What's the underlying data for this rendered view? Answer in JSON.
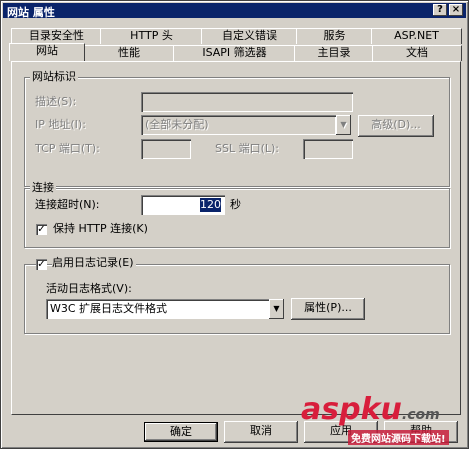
{
  "window": {
    "title": "网站 属性"
  },
  "title_buttons": {
    "help": "?",
    "close": "×"
  },
  "tabs_row1": [
    "目录安全性",
    "HTTP 头",
    "自定义错误",
    "服务",
    "ASP.NET"
  ],
  "tabs_row2": [
    "网站",
    "性能",
    "ISAPI 筛选器",
    "主目录",
    "文档"
  ],
  "site_id": {
    "group": "网站标识",
    "desc_label": "描述(S):",
    "desc_value": "",
    "ip_label": "IP 地址(I):",
    "ip_value": "(全部未分配)",
    "advanced": "高级(D)...",
    "tcp_label": "TCP 端口(T):",
    "tcp_value": "",
    "ssl_label": "SSL 端口(L):",
    "ssl_value": ""
  },
  "connection": {
    "group": "连接",
    "timeout_label": "连接超时(N):",
    "timeout_value": "120",
    "unit": "秒",
    "keepalive_label": "保持 HTTP 连接(K)",
    "keepalive_checked": true
  },
  "logging": {
    "enable_label": "启用日志记录(E)",
    "enabled": true,
    "format_label": "活动日志格式(V):",
    "format_value": "W3C 扩展日志文件格式",
    "properties": "属性(P)..."
  },
  "footer": {
    "ok": "确定",
    "cancel": "取消",
    "apply": "应用",
    "help": "帮助"
  },
  "watermark": {
    "brand": "aspku",
    "tld": ".com",
    "sub": "免费网站源码下载站!"
  }
}
